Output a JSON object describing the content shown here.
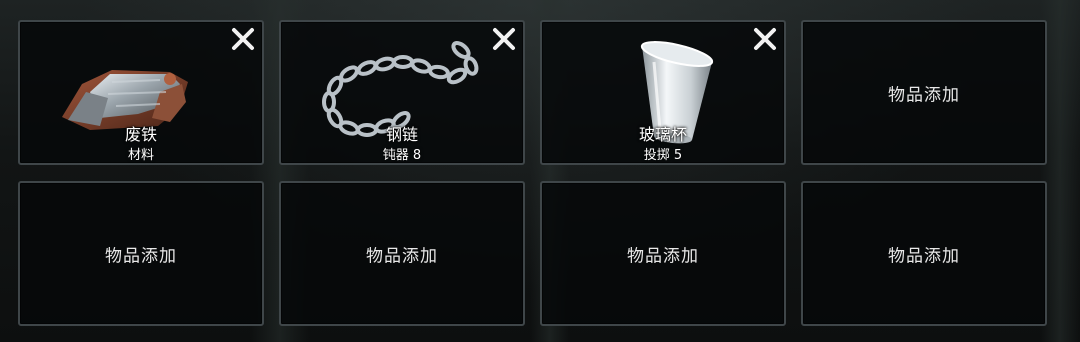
{
  "slots": [
    {
      "name": "废铁",
      "subtitle": "材料",
      "icon": "scrap-metal-icon",
      "removable": true
    },
    {
      "name": "钢链",
      "subtitle": "钝器 8",
      "icon": "steel-chain-icon",
      "removable": true
    },
    {
      "name": "玻璃杯",
      "subtitle": "投掷 5",
      "icon": "glass-cup-icon",
      "removable": true
    },
    {
      "add_label": "物品添加"
    },
    {
      "add_label": "物品添加"
    },
    {
      "add_label": "物品添加"
    },
    {
      "add_label": "物品添加"
    },
    {
      "add_label": "物品添加"
    }
  ],
  "colors": {
    "slot_border": "#3f4649",
    "slot_bg": "#06080a",
    "text": "#ffffff"
  }
}
